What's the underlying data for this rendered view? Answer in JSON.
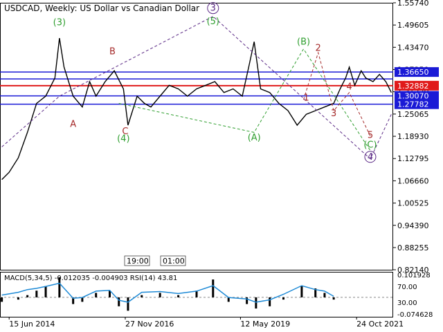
{
  "title": "USDCAD, Weekly:  US Dollar vs Canadian Dollar",
  "colors": {
    "background": "#ffffff",
    "price_line": "#000000",
    "blue_level": "#1a1ad6",
    "red_level": "#e01a1a",
    "wave_green": "#2e9e2e",
    "wave_red": "#a52a2a",
    "wave_purple": "#5b2a86",
    "macd_histogram": "#000000",
    "rsi_line": "#1e8ad6",
    "macd_signal": "#e01a1a"
  },
  "chart_data": [
    {
      "type": "line",
      "name": "price",
      "y_ticks": [
        1.5574,
        1.49605,
        1.4347,
        1.3735,
        1.3122,
        1.25065,
        1.1893,
        1.12795,
        1.0666,
        1.00525,
        0.9439,
        0.88255,
        0.8214
      ],
      "ylim": [
        0.8214,
        1.5574
      ],
      "x_ticks": [
        "15 Jun 2014",
        "27 Nov 2016",
        "12 May 2019",
        "24 Oct 2021"
      ],
      "x_tick_positions_week": [
        0,
        127,
        253,
        380
      ],
      "levels": [
        {
          "value": 1.3665,
          "color": "blue",
          "label": "1.36650"
        },
        {
          "value": 1.32882,
          "color": "red",
          "label": "1.32882"
        },
        {
          "value": 1.3007,
          "color": "blue",
          "label": "1.30070"
        },
        {
          "value": 1.27782,
          "color": "blue",
          "label": "1.27782"
        },
        {
          "value": 1.3475,
          "color": "blue",
          "label": ""
        }
      ],
      "price_x_weeks": [
        -8,
        0,
        10,
        20,
        30,
        40,
        50,
        55,
        60,
        70,
        80,
        88,
        95,
        105,
        115,
        125,
        130,
        140,
        148,
        155,
        165,
        175,
        185,
        195,
        205,
        215,
        225,
        235,
        245,
        255,
        262,
        268,
        275,
        285,
        295,
        305,
        315,
        325,
        335,
        345,
        355,
        362,
        368,
        372,
        378,
        385,
        390,
        398,
        405,
        412,
        418
      ],
      "price_y": [
        1.07,
        1.09,
        1.13,
        1.2,
        1.28,
        1.3,
        1.35,
        1.46,
        1.38,
        1.3,
        1.27,
        1.34,
        1.3,
        1.34,
        1.37,
        1.32,
        1.22,
        1.3,
        1.28,
        1.27,
        1.3,
        1.33,
        1.32,
        1.3,
        1.32,
        1.33,
        1.34,
        1.31,
        1.32,
        1.3,
        1.38,
        1.45,
        1.32,
        1.31,
        1.28,
        1.26,
        1.22,
        1.25,
        1.26,
        1.27,
        1.28,
        1.32,
        1.35,
        1.38,
        1.33,
        1.37,
        1.35,
        1.34,
        1.36,
        1.34,
        1.31
      ],
      "wave_labels": [
        {
          "text": "(3)",
          "color": "green",
          "x_week": 55,
          "y": 1.495
        },
        {
          "text": "A",
          "color": "red",
          "x_week": 70,
          "y": 1.215
        },
        {
          "text": "B",
          "color": "red",
          "x_week": 113,
          "y": 1.415
        },
        {
          "text": "C",
          "color": "red",
          "x_week": 127,
          "y": 1.195
        },
        {
          "text": "(4)",
          "color": "green",
          "x_week": 125,
          "y": 1.175
        },
        {
          "text": "3",
          "color": "purple",
          "x_week": 223,
          "y": 1.535,
          "circled": true
        },
        {
          "text": "(5)",
          "color": "green",
          "x_week": 223,
          "y": 1.498
        },
        {
          "text": "(A)",
          "color": "green",
          "x_week": 268,
          "y": 1.178
        },
        {
          "text": "(B)",
          "color": "green",
          "x_week": 322,
          "y": 1.442
        },
        {
          "text": "2",
          "color": "red",
          "x_week": 338,
          "y": 1.425
        },
        {
          "text": "1",
          "color": "red",
          "x_week": 325,
          "y": 1.288
        },
        {
          "text": "4",
          "color": "red",
          "x_week": 372,
          "y": 1.318
        },
        {
          "text": "3",
          "color": "red",
          "x_week": 355,
          "y": 1.245
        },
        {
          "text": "5",
          "color": "red",
          "x_week": 395,
          "y": 1.185
        },
        {
          "text": "(C)",
          "color": "green",
          "x_week": 395,
          "y": 1.158
        },
        {
          "text": "4",
          "color": "purple",
          "x_week": 395,
          "y": 1.125,
          "circled": true
        }
      ],
      "elliott_paths": [
        {
          "color": "purple",
          "points": [
            [
              -8,
              1.16
            ],
            [
              55,
              1.3
            ],
            [
              223,
              1.52
            ],
            [
              395,
              1.127
            ],
            [
              418,
              1.25
            ]
          ]
        },
        {
          "color": "green",
          "points": [
            [
              120,
              1.28
            ],
            [
              268,
              1.2
            ],
            [
              322,
              1.43
            ],
            [
              395,
              1.15
            ]
          ]
        },
        {
          "color": "red",
          "points": [
            [
              322,
              1.29
            ],
            [
              338,
              1.42
            ],
            [
              355,
              1.26
            ],
            [
              372,
              1.31
            ],
            [
              395,
              1.19
            ]
          ]
        }
      ],
      "time_markers": [
        "19:00",
        "01:00"
      ]
    },
    {
      "type": "line",
      "name": "indicators",
      "label": "MACD(5,34,5) -0.012035 -0.004903 RSI(14) 43.81",
      "left_ticks": [
        0.101928,
        -0.074628
      ],
      "right_ticks": [
        70.0,
        30.0
      ],
      "macd_histogram_weeks": [
        -8,
        10,
        20,
        30,
        40,
        55,
        70,
        80,
        95,
        110,
        120,
        130,
        145,
        165,
        185,
        205,
        223,
        240,
        260,
        270,
        285,
        300,
        320,
        335,
        345,
        355
      ],
      "macd_histogram": [
        -0.02,
        -0.01,
        0.01,
        0.03,
        0.05,
        0.09,
        -0.03,
        -0.02,
        0.02,
        0.03,
        -0.04,
        -0.06,
        0.01,
        0.02,
        0.01,
        0.03,
        0.08,
        -0.02,
        -0.03,
        -0.05,
        -0.04,
        -0.01,
        0.05,
        0.04,
        0.02,
        -0.01
      ],
      "rsi": [
        48,
        55,
        62,
        65,
        70,
        78,
        40,
        42,
        58,
        60,
        35,
        30,
        55,
        57,
        52,
        58,
        72,
        42,
        38,
        30,
        36,
        50,
        72,
        62,
        58,
        45
      ]
    }
  ]
}
